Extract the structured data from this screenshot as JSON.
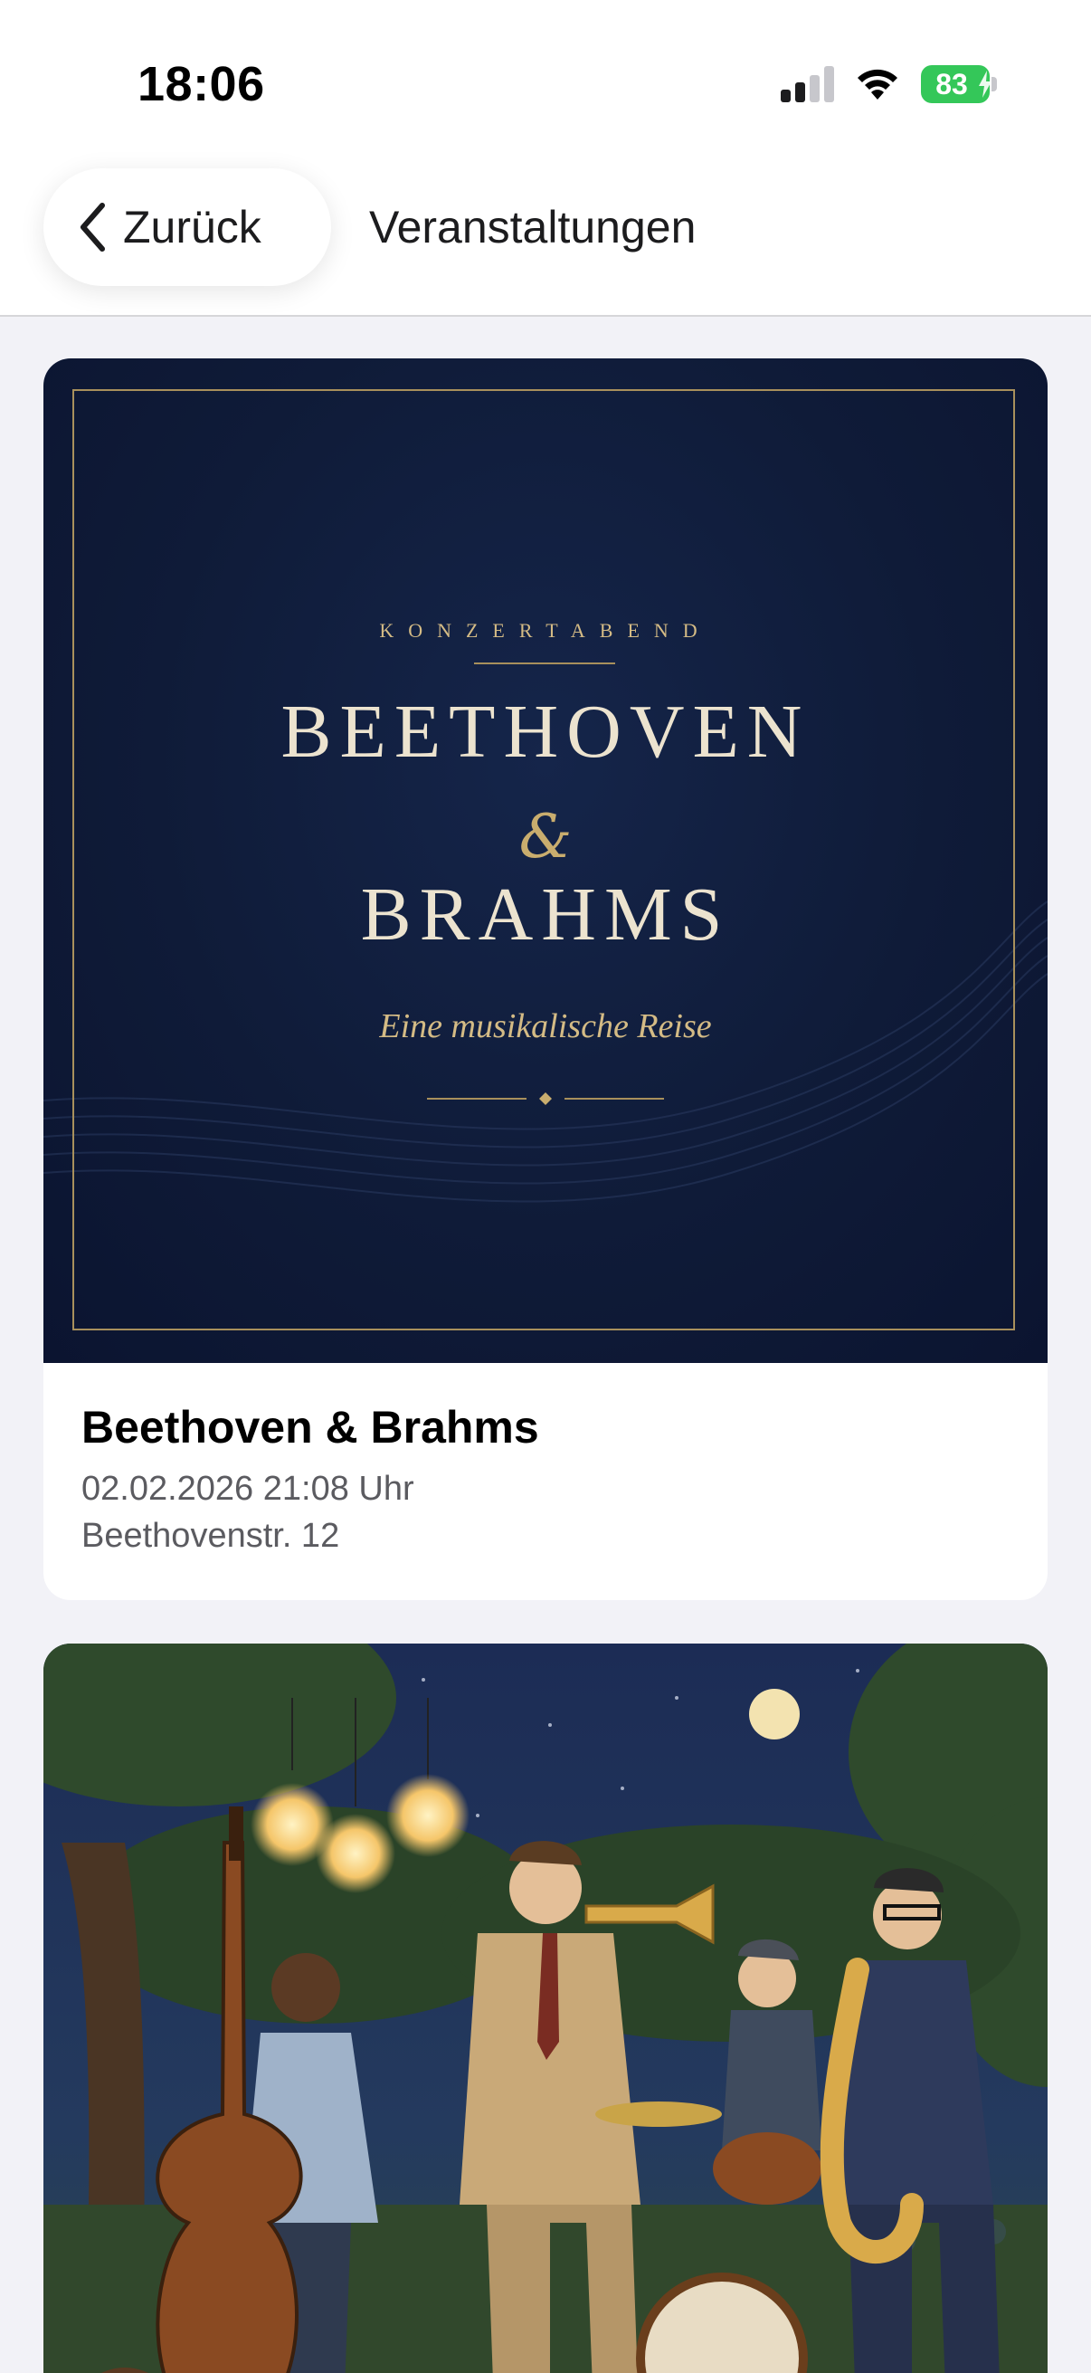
{
  "status_bar": {
    "time": "18:06",
    "battery": "83",
    "icons": [
      "signal-icon",
      "wifi-icon",
      "battery-icon"
    ]
  },
  "nav": {
    "back_label": "Zurück",
    "title": "Veranstaltungen"
  },
  "events": [
    {
      "poster": {
        "kicker": "KONZERTABEND",
        "title_line_1": "BEETHOVEN",
        "ampersand": "&",
        "title_line_2": "BRAHMS",
        "subtitle": "Eine musikalische Reise"
      },
      "title": "Beethoven & Brahms",
      "date": "02.02.2026 21:08 Uhr",
      "location": "Beethovenstr. 12"
    },
    {
      "poster": {
        "description_icon": "jazz-band-illustration"
      }
    }
  ],
  "colors": {
    "accent_gold": "#c9ad6e",
    "poster_navy": "#0f1b38",
    "battery_green": "#34c759",
    "background": "#f2f2f7"
  }
}
